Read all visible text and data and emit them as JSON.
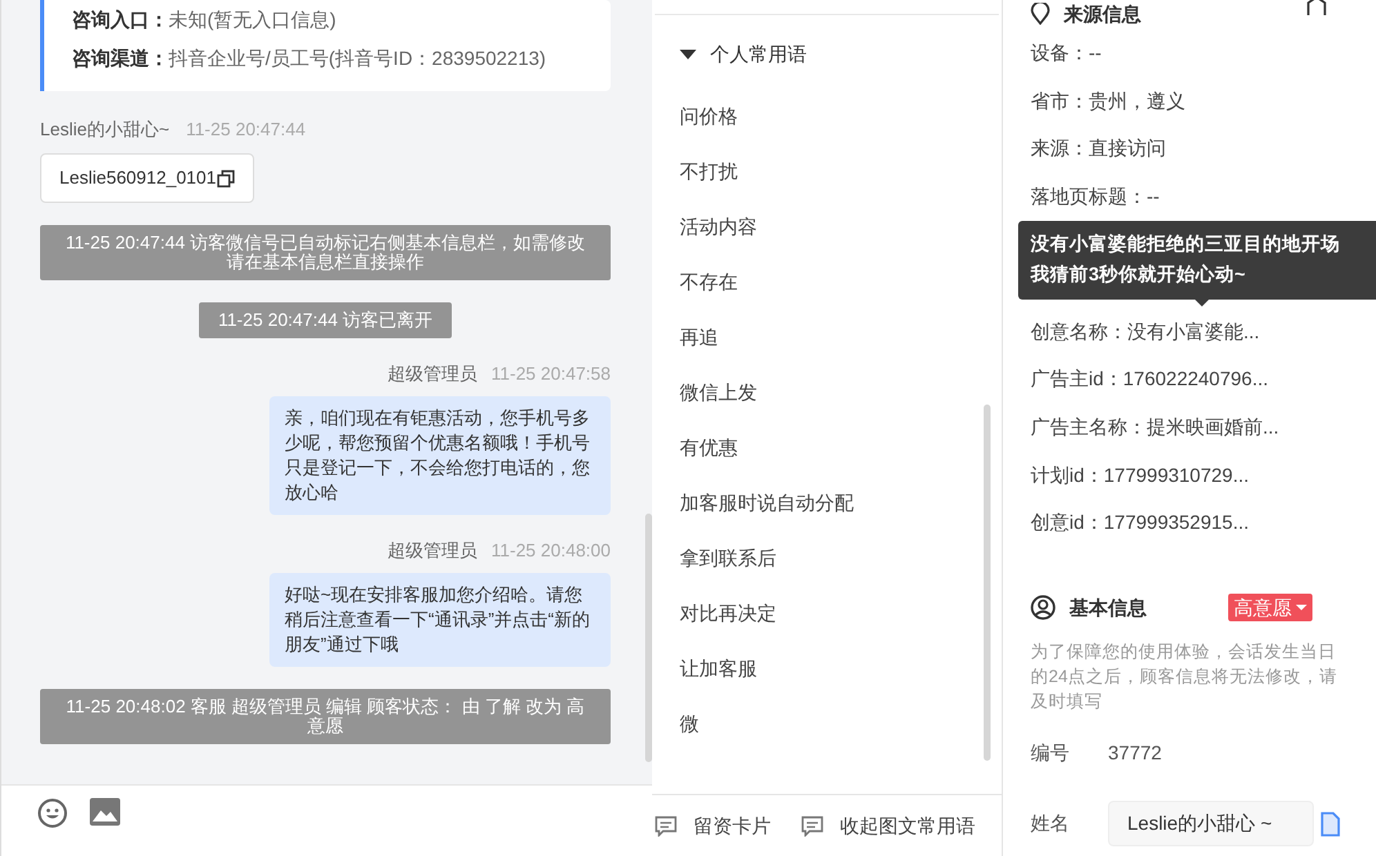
{
  "chat": {
    "info_card": [
      {
        "label": "咨询入口：",
        "value": "未知(暂无入口信息)"
      },
      {
        "label": "咨询渠道：",
        "value": "抖音企业号/员工号(抖音号ID：2839502213)"
      }
    ],
    "messages": [
      {
        "kind": "contact_card",
        "sender": "Leslie的小甜心~",
        "time": "11-25 20:47:44",
        "text": "Leslie560912_0101"
      },
      {
        "kind": "system",
        "text": "11-25 20:47:44 访客微信号已自动标记右侧基本信息栏，如需修改请在基本信息栏直接操作"
      },
      {
        "kind": "system",
        "text": "11-25 20:47:44 访客已离开"
      },
      {
        "kind": "outgoing",
        "sender": "超级管理员",
        "time": "11-25 20:47:58",
        "text": "亲，咱们现在有钜惠活动，您手机号多少呢，帮您预留个优惠名额哦！手机号只是登记一下，不会给您打电话的，您放心哈"
      },
      {
        "kind": "outgoing",
        "sender": "超级管理员",
        "time": "11-25 20:48:00",
        "text": "好哒~现在安排客服加您介绍哈。请您稍后注意查看一下“通讯录”并点击“新的朋友”通过下哦"
      },
      {
        "kind": "system",
        "text": "11-25 20:48:02 客服 超级管理员 编辑 顾客状态： 由 了解 改为 高意愿"
      }
    ]
  },
  "phrases": {
    "group": "个人常用语",
    "expanded": true,
    "items": [
      "问价格",
      "不打扰",
      "活动内容",
      "不存在",
      "再追",
      "微信上发",
      "有优惠",
      "加客服时说自动分配",
      "拿到联系后",
      "对比再决定",
      "让加客服",
      "微"
    ],
    "footer": [
      "留资卡片",
      "收起图文常用语"
    ]
  },
  "source": {
    "title": "来源信息",
    "fields_above": [
      "设备：--",
      "省市：贵州，遵义",
      "来源：直接访问",
      "落地页标题：--"
    ],
    "tooltip": [
      "没有小富婆能拒绝的三亚目的地开场",
      "我猜前3秒你就开始心动~"
    ],
    "fields_below": [
      "创意名称：没有小富婆能...",
      "广告主id：176022240796...",
      "广告主名称：提米映画婚前...",
      "计划id：177999310729...",
      "创意id：177999352915..."
    ]
  },
  "basic": {
    "title": "基本信息",
    "status": "高意愿",
    "notice": "为了保障您的使用体验，会话发生当日的24点之后，顾客信息将无法修改，请及时填写",
    "fields": [
      {
        "kind": "text",
        "label": "编号",
        "value": "37772"
      },
      {
        "kind": "input",
        "label": "姓名",
        "value": "Leslie的小甜心 ~"
      }
    ]
  }
}
